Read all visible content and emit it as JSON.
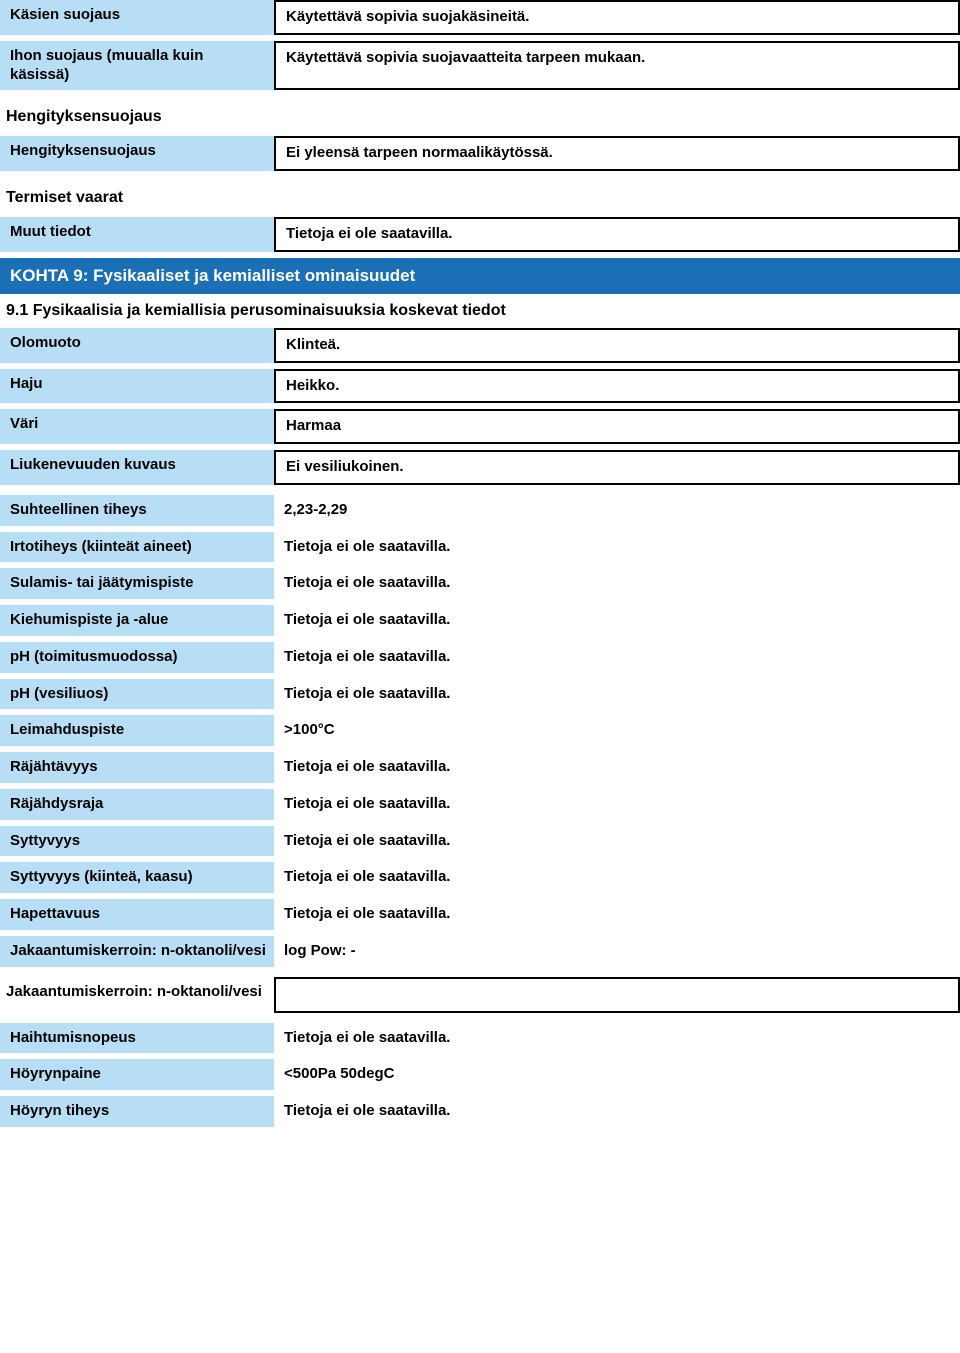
{
  "section8": {
    "rows": [
      {
        "label": "Käsien suojaus",
        "value": "Käytettävä sopivia suojakäsineitä.",
        "labelStyle": "blue",
        "valueStyle": "box"
      },
      {
        "label": "Ihon suojaus (muualla kuin käsissä)",
        "value": "Käytettävä sopivia suojavaatteita tarpeen mukaan.",
        "labelStyle": "blue",
        "valueStyle": "box"
      }
    ],
    "subheading1": "Hengityksensuojaus",
    "rows2": [
      {
        "label": "Hengityksensuojaus",
        "value": "Ei yleensä tarpeen normaalikäytössä.",
        "labelStyle": "blue",
        "valueStyle": "box"
      }
    ],
    "subheading2": "Termiset vaarat",
    "rows3": [
      {
        "label": "Muut tiedot",
        "value": "Tietoja ei ole saatavilla.",
        "labelStyle": "blue",
        "valueStyle": "box"
      }
    ]
  },
  "section9": {
    "banner": "KOHTA 9: Fysikaaliset ja kemialliset ominaisuudet",
    "subheading": "9.1 Fysikaalisia ja kemiallisia perusominaisuuksia koskevat tiedot",
    "rowsBoxed": [
      {
        "label": "Olomuoto",
        "value": "Klinteä."
      },
      {
        "label": "Haju",
        "value": "Heikko."
      },
      {
        "label": "Väri",
        "value": "Harmaa"
      },
      {
        "label": "Liukenevuuden kuvaus",
        "value": "Ei vesiliukoinen."
      }
    ],
    "rowsPlain": [
      {
        "label": "Suhteellinen tiheys",
        "value": "2,23-2,29"
      },
      {
        "label": "Irtotiheys (kiinteät aineet)",
        "value": "Tietoja ei ole saatavilla."
      },
      {
        "label": "Sulamis- tai jäätymispiste",
        "value": "Tietoja ei ole saatavilla."
      },
      {
        "label": "Kiehumispiste ja -alue",
        "value": "Tietoja ei ole saatavilla."
      },
      {
        "label": "pH (toimitusmuodossa)",
        "value": "Tietoja ei ole saatavilla."
      },
      {
        "label": "pH (vesiliuos)",
        "value": "Tietoja ei ole saatavilla."
      },
      {
        "label": "Leimahduspiste",
        "value": ">100°C"
      },
      {
        "label": "Räjähtävyys",
        "value": "Tietoja ei ole saatavilla."
      },
      {
        "label": "Räjähdysraja",
        "value": "Tietoja ei ole saatavilla."
      },
      {
        "label": "Syttyvyys",
        "value": "Tietoja ei ole saatavilla."
      },
      {
        "label": "Syttyvyys (kiinteä, kaasu)",
        "value": "Tietoja ei ole saatavilla."
      },
      {
        "label": "Hapettavuus",
        "value": "Tietoja ei ole saatavilla."
      },
      {
        "label": "Jakaantumiskerroin: n-oktanoli/vesi",
        "value": "log Pow:    -"
      }
    ],
    "rowBoxedEmpty": {
      "label": "Jakaantumiskerroin: n-oktanoli/vesi",
      "value": " "
    },
    "rowsPlain2": [
      {
        "label": "Haihtumisnopeus",
        "value": "Tietoja ei ole saatavilla."
      },
      {
        "label": "Höyrynpaine",
        "value": "<500Pa 50degC"
      },
      {
        "label": "Höyryn tiheys",
        "value": "Tietoja ei ole saatavilla."
      }
    ]
  }
}
